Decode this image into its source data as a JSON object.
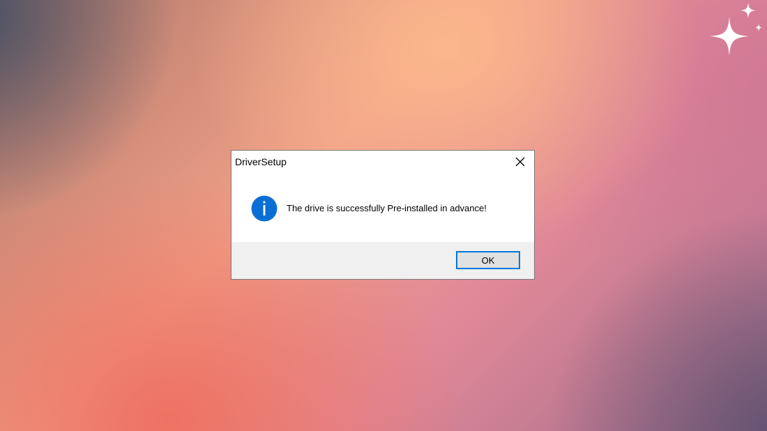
{
  "dialog": {
    "title": "DriverSetup",
    "message": "The drive is successfully Pre-installed in advance!",
    "ok_label": "OK",
    "close_icon": "close-icon",
    "message_icon": "info-icon"
  },
  "colors": {
    "accent": "#0078d7",
    "footer_bg": "#f0f0f0",
    "dialog_bg": "#ffffff"
  }
}
